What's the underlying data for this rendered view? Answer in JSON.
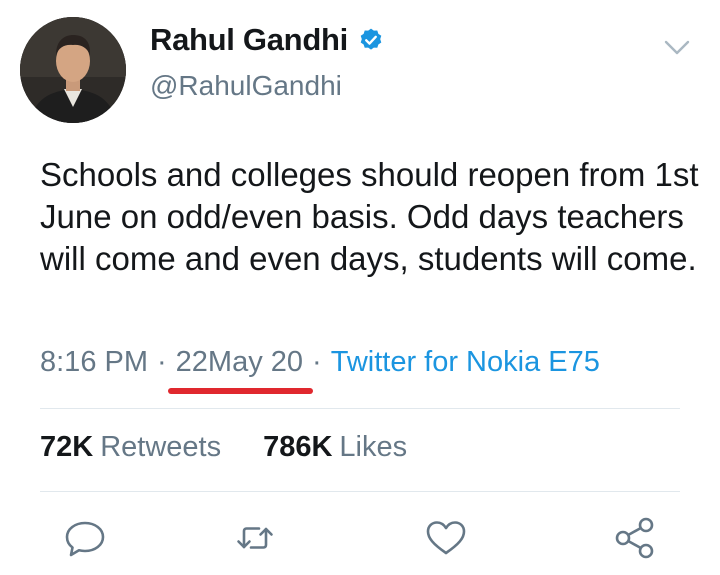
{
  "user": {
    "name": "Rahul Gandhi",
    "handle": "@RahulGandhi",
    "verified": true
  },
  "tweet": {
    "text": "Schools and colleges should reopen from 1st June on odd/even basis. Odd days teachers will come and even days, students will come.",
    "time": "8:16 PM",
    "date": "22May 20",
    "separator": "·",
    "source": "Twitter for Nokia E75"
  },
  "stats": {
    "retweets_count": "72K",
    "retweets_label": "Retweets",
    "likes_count": "786K",
    "likes_label": "Likes"
  },
  "icons": {
    "menu": "chevron-down-icon",
    "verified": "verified-badge-icon",
    "reply": "reply-icon",
    "retweet": "retweet-icon",
    "like": "heart-icon",
    "share": "share-icon"
  },
  "colors": {
    "accent": "#1b95e0",
    "muted": "#657786",
    "text": "#14171a",
    "annotation": "#e0282e"
  }
}
